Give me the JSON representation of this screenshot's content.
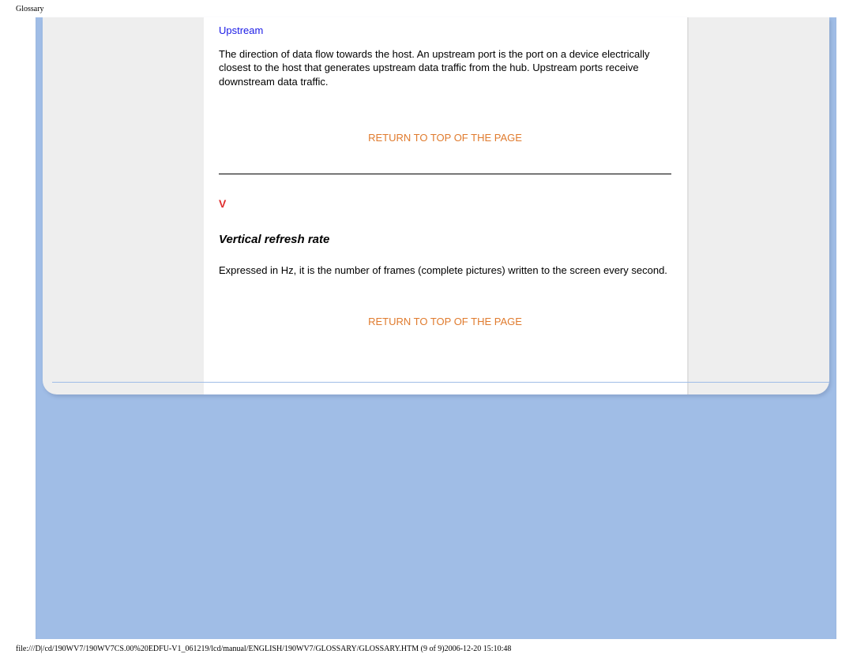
{
  "header_small": "Glossary",
  "upstream": {
    "label": "Upstream",
    "body": "The direction of data flow towards the host. An upstream port is the port on a device electrically closest to the host that generates upstream data traffic from the hub. Upstream ports receive downstream data traffic."
  },
  "return_link_text": "RETURN TO TOP OF THE PAGE",
  "section_letter": "V",
  "term": {
    "title": "Vertical refresh rate",
    "definition": "Expressed in Hz, it is the number of frames (complete pictures) written to the screen every second."
  },
  "footer": "file:///D|/cd/190WV7/190WV7CS.00%20EDFU-V1_061219/lcd/manual/ENGLISH/190WV7/GLOSSARY/GLOSSARY.HTM (9 of 9)2006-12-20 15:10:48"
}
